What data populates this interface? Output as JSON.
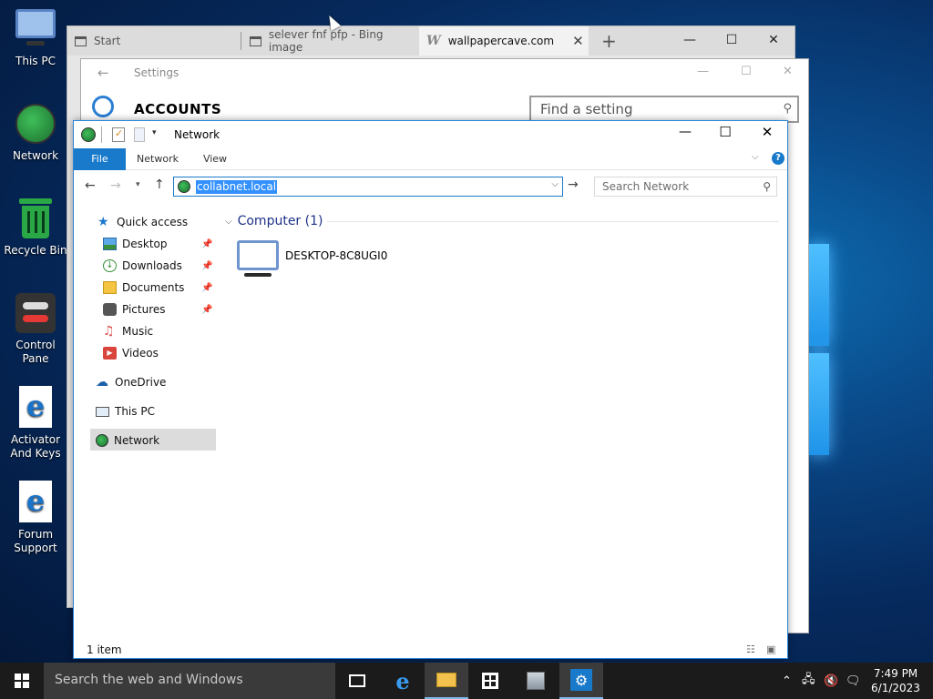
{
  "desktop": {
    "icons": [
      {
        "label": "This PC"
      },
      {
        "label": "Network"
      },
      {
        "label": "Recycle Bin"
      },
      {
        "label": "Control Pane"
      },
      {
        "label": "Activator And Keys"
      },
      {
        "label": "Forum Support"
      }
    ]
  },
  "browser": {
    "tabs": [
      {
        "label": "Start"
      },
      {
        "label": "selever fnf pfp - Bing image"
      },
      {
        "label": "wallpapercave.com"
      }
    ],
    "new_tab_symbol": "+",
    "controls": {
      "minimize": "—",
      "maximize": "☐",
      "close": "✕"
    }
  },
  "settings": {
    "title": "Settings",
    "heading": "ACCOUNTS",
    "search_placeholder": "Find a setting"
  },
  "explorer": {
    "title": "Network",
    "ribbon_tabs": [
      "File",
      "Network",
      "View"
    ],
    "address_value": "collabnet.local",
    "search_placeholder": "Search Network",
    "nav": {
      "quick_access": "Quick access",
      "items": [
        {
          "label": "Desktop",
          "pinned": true
        },
        {
          "label": "Downloads",
          "pinned": true
        },
        {
          "label": "Documents",
          "pinned": true
        },
        {
          "label": "Pictures",
          "pinned": true
        },
        {
          "label": "Music",
          "pinned": false
        },
        {
          "label": "Videos",
          "pinned": false
        }
      ],
      "onedrive": "OneDrive",
      "this_pc": "This PC",
      "network": "Network"
    },
    "group_header": "Computer (1)",
    "items": [
      {
        "label": "DESKTOP-8C8UGI0"
      }
    ],
    "status": "1 item"
  },
  "taskbar": {
    "search_placeholder": "Search the web and Windows",
    "time": "7:49 PM",
    "date": "6/1/2023"
  },
  "colors": {
    "accent": "#1979ca",
    "selection": "#3390ff",
    "group_header": "#1e3287"
  }
}
